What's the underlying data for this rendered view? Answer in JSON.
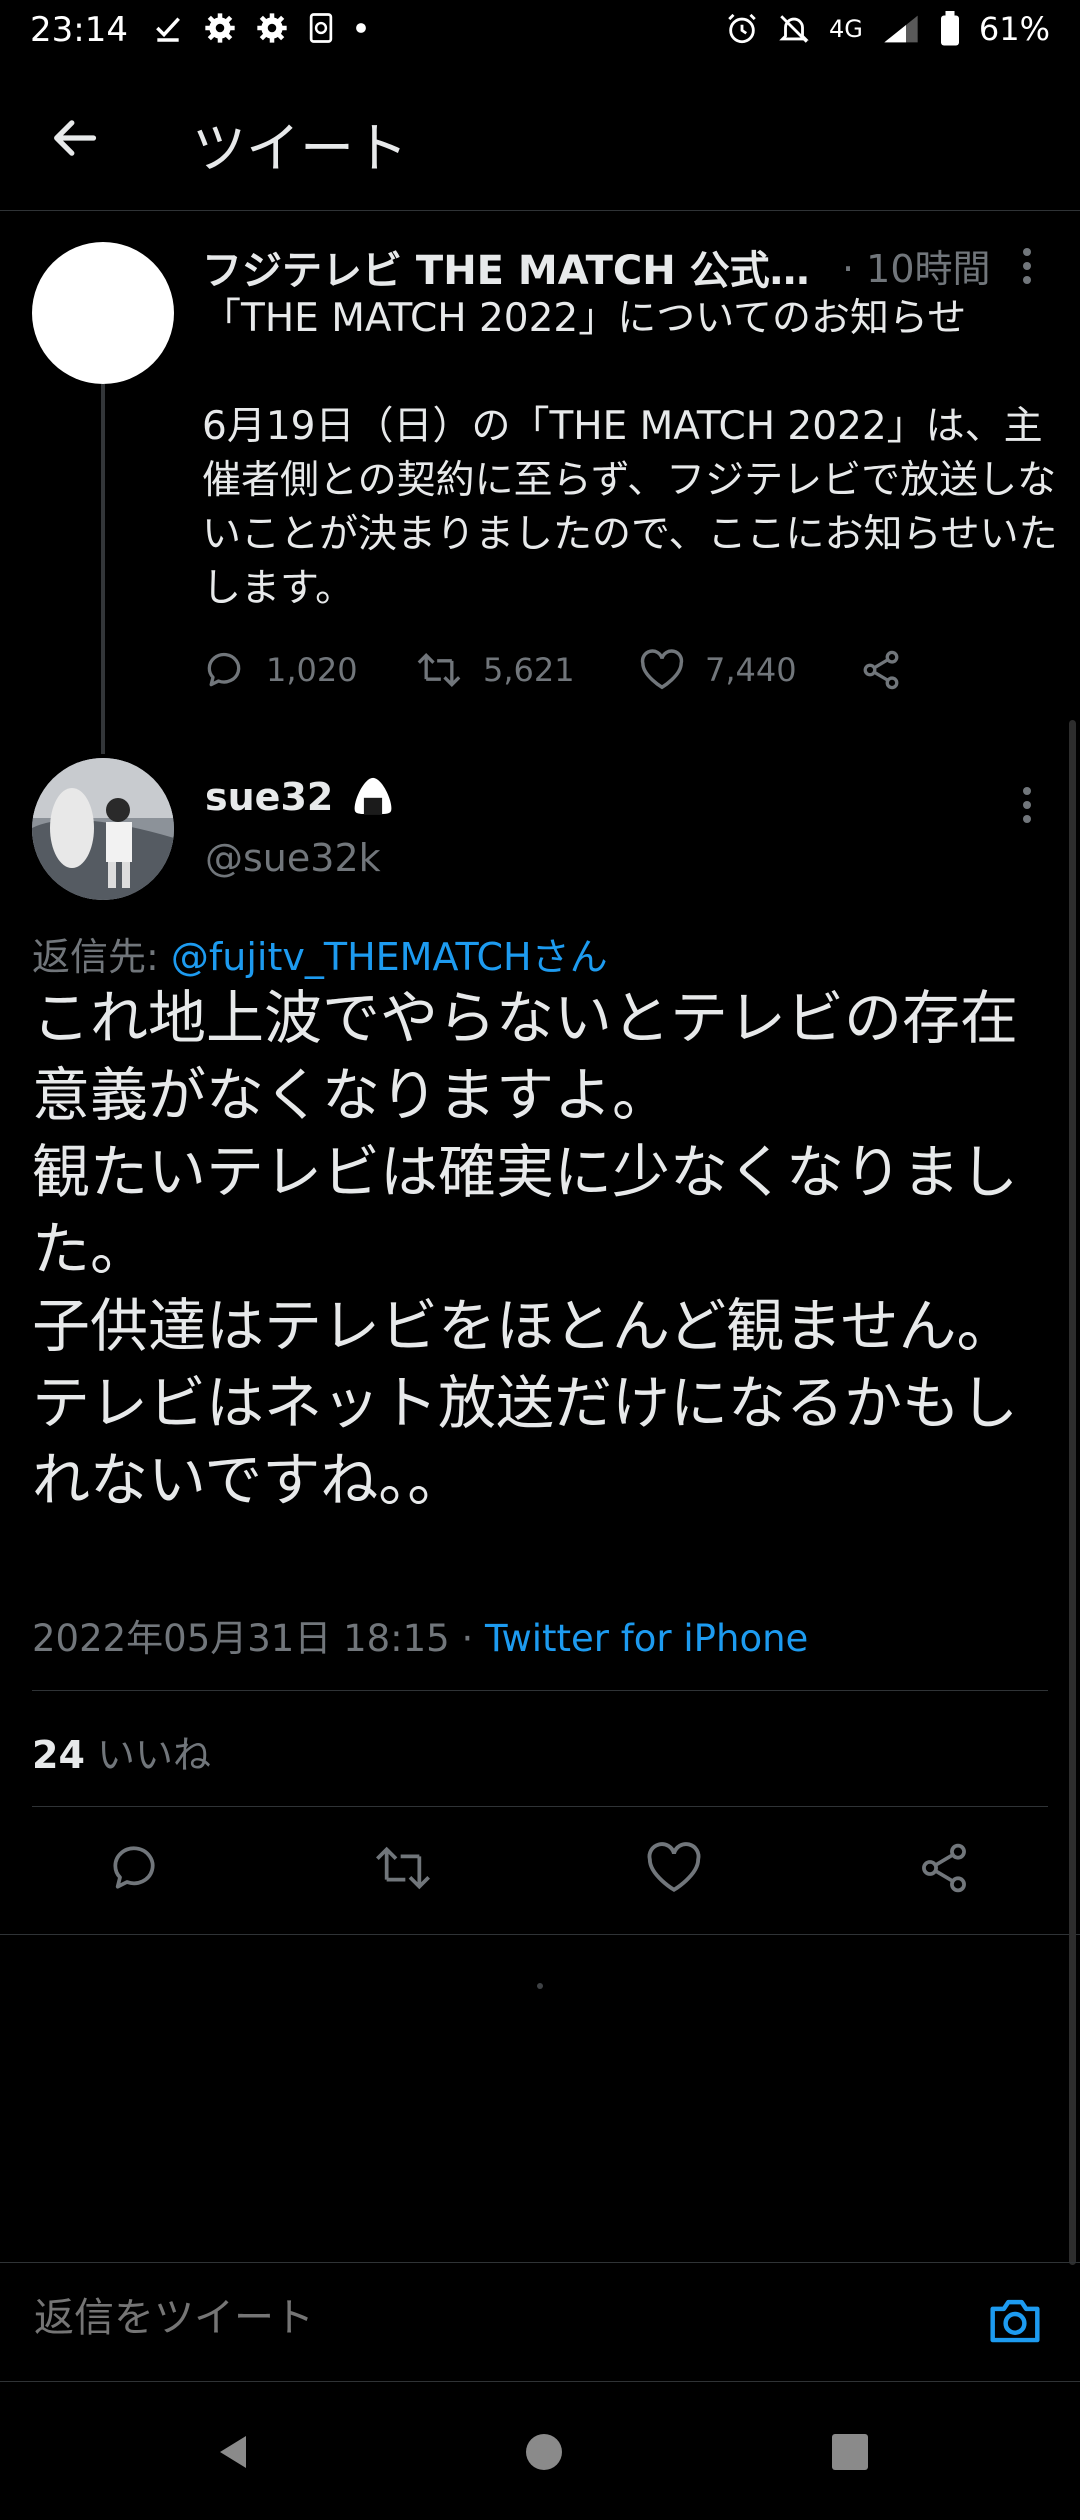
{
  "status_bar": {
    "time": "23:14",
    "network": "4G",
    "battery": "61%",
    "left_icons": [
      "check-icon",
      "settings-icon",
      "settings-icon",
      "app-icon",
      "dot-icon"
    ],
    "right_icons": [
      "alarm-icon",
      "mute-icon",
      "signal-icon",
      "battery-icon"
    ]
  },
  "header": {
    "title": "ツイート"
  },
  "parent_tweet": {
    "name": "フジテレビ THE MATCH 公式 …",
    "time": "· 10時間",
    "body": "「THE MATCH 2022」についてのお知らせ\n\n6月19日（日）の「THE MATCH 2022」は、主催者側との契約に至らず、フジテレビで放送しないことが決まりましたので、ここにお知らせいたします。",
    "replies": "1,020",
    "retweets": "5,621",
    "likes": "7,440"
  },
  "reply_tweet": {
    "name": "sue32",
    "handle": "@sue32k",
    "replying_label": "返信先: ",
    "replying_to": "@fujitv_THEMATCHさん",
    "body": "これ地上波でやらないとテレビの存在意義がなくなりますよ。\n観たいテレビは確実に少なくなりました。\n子供達はテレビをほとんど観ません。\nテレビはネット放送だけになるかもしれないですね。。",
    "timestamp": "2022年05月31日 18:15 · ",
    "source": "Twitter for iPhone",
    "like_count": "24",
    "like_label": " いいね"
  },
  "compose": {
    "placeholder": "返信をツイート"
  },
  "colors": {
    "accent": "#1d9bf0",
    "background": "#000000",
    "muted": "#71767b",
    "text": "#e7e9ea"
  }
}
